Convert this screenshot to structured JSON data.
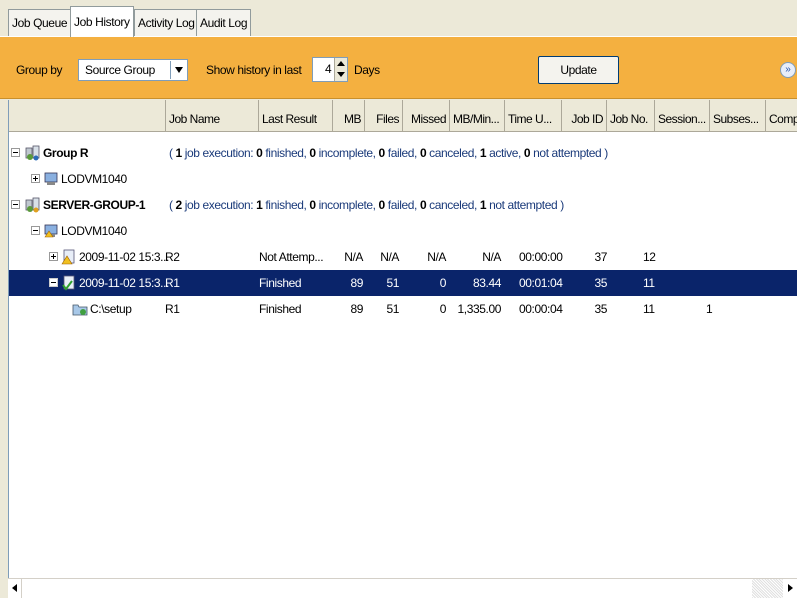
{
  "tabs": [
    {
      "label": "Job Queue",
      "active": false
    },
    {
      "label": "Job History",
      "active": true
    },
    {
      "label": "Activity Log",
      "active": false
    },
    {
      "label": "Audit Log",
      "active": false
    }
  ],
  "toolbar": {
    "group_by_label": "Group by",
    "group_by_value": "Source Group",
    "show_history_label": "Show history in last",
    "days_value": "4",
    "days_label": "Days",
    "update_label": "Update",
    "expand_glyph": "»"
  },
  "columns": [
    "Job Name",
    "Last Result",
    "MB",
    "Files",
    "Missed",
    "MB/Min...",
    "Time U...",
    "Job ID",
    "Job No.",
    "Session...",
    "Subses...",
    "Comp"
  ],
  "groups": [
    {
      "name": "Group R",
      "summary": {
        "count": "1",
        "executions": "job execution:",
        "finished": "0",
        "incomplete": "0",
        "failed": "0",
        "canceled": "0",
        "active": "1",
        "not_attempted": "0"
      },
      "server": "LODVM1040"
    },
    {
      "name": "SERVER-GROUP-1",
      "summary": {
        "count": "2",
        "executions": "job execution:",
        "finished": "1",
        "incomplete": "0",
        "failed": "0",
        "canceled": "0",
        "not_attempted": "1"
      },
      "server": "LODVM1040"
    }
  ],
  "rows": [
    {
      "name": "2009-11-02 15:3...",
      "job_name": "R2",
      "last_result": "Not Attemp...",
      "mb": "N/A",
      "files": "N/A",
      "missed": "N/A",
      "mbmin": "N/A",
      "time": "00:00:00",
      "job_id": "37",
      "job_no": "12",
      "session": "",
      "subses": ""
    },
    {
      "name": "2009-11-02 15:3...",
      "job_name": "R1",
      "last_result": "Finished",
      "mb": "89",
      "files": "51",
      "missed": "0",
      "mbmin": "83.44",
      "time": "00:01:04",
      "job_id": "35",
      "job_no": "11",
      "session": "",
      "subses": ""
    },
    {
      "name": "C:\\setup",
      "job_name": "R1",
      "last_result": "Finished",
      "mb": "89",
      "files": "51",
      "missed": "0",
      "mbmin": "1,335.00",
      "time": "00:00:04",
      "job_id": "35",
      "job_no": "11",
      "session": "1",
      "subses": ""
    }
  ],
  "text": {
    "paren_open": "(",
    "paren_close": ")",
    "finished": "finished,",
    "incomplete": "incomplete,",
    "failed": "failed,",
    "canceled": "canceled,",
    "active": "active,",
    "not_attempted": "not attempted"
  },
  "colors": {
    "toolbar_bg": "#f4b040",
    "selection": "#0a246a"
  }
}
